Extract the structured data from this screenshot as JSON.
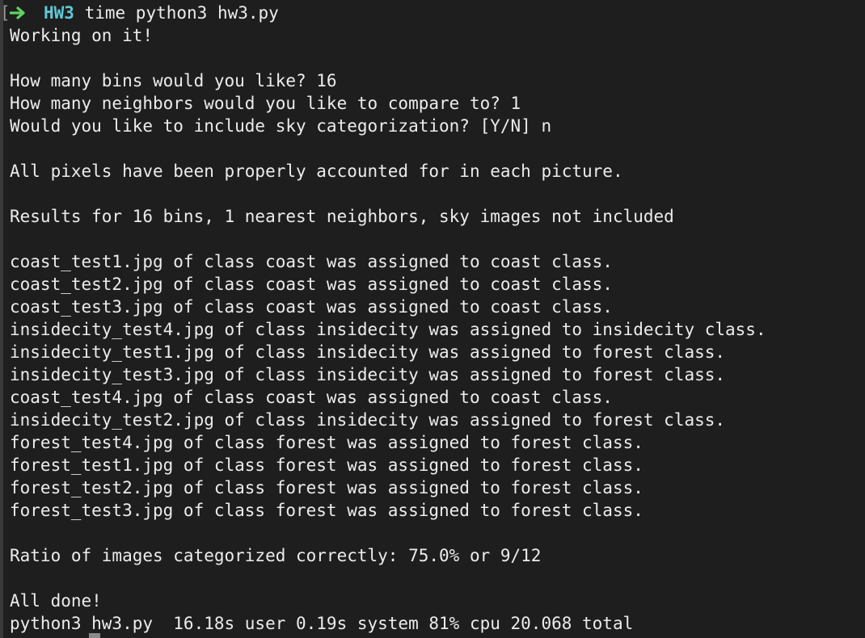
{
  "prompt": {
    "bracket": "[",
    "directory": "HW3",
    "command": "time python3 hw3.py"
  },
  "lines": [
    "Working on it!",
    "",
    "How many bins would you like? 16",
    "How many neighbors would you like to compare to? 1",
    "Would you like to include sky categorization? [Y/N] n",
    "",
    "All pixels have been properly accounted for in each picture.",
    "",
    "Results for 16 bins, 1 nearest neighbors, sky images not included",
    "",
    "coast_test1.jpg of class coast was assigned to coast class.",
    "coast_test2.jpg of class coast was assigned to coast class.",
    "coast_test3.jpg of class coast was assigned to coast class.",
    "insidecity_test4.jpg of class insidecity was assigned to insidecity class.",
    "insidecity_test1.jpg of class insidecity was assigned to forest class.",
    "insidecity_test3.jpg of class insidecity was assigned to forest class.",
    "coast_test4.jpg of class coast was assigned to coast class.",
    "insidecity_test2.jpg of class insidecity was assigned to forest class.",
    "forest_test4.jpg of class forest was assigned to forest class.",
    "forest_test1.jpg of class forest was assigned to forest class.",
    "forest_test2.jpg of class forest was assigned to forest class.",
    "forest_test3.jpg of class forest was assigned to forest class.",
    "",
    "Ratio of images categorized correctly: 75.0% or 9/12",
    "",
    "All done!",
    "python3 hw3.py  16.18s user 0.19s system 81% cpu 20.068 total"
  ],
  "colors": {
    "background": "#1e1e1e",
    "text": "#ececec",
    "arrow": "#5fd35f",
    "directory": "#5fc8d8"
  },
  "icons": {
    "prompt_arrow": "arrow-right-icon"
  }
}
